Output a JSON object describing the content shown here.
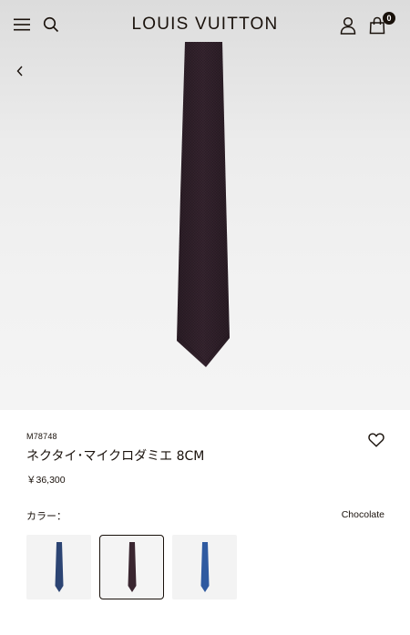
{
  "header": {
    "logo": "LOUIS VUITTON",
    "cart_count": "0",
    "icons": [
      "menu-icon",
      "search-icon",
      "account-icon",
      "shopping-bag-icon",
      "back-arrow-icon"
    ]
  },
  "product": {
    "sku": "M78748",
    "name": "ネクタイ･マイクロダミエ 8CM",
    "price": "￥36,300",
    "wishlist_icon": "heart-icon"
  },
  "color_selector": {
    "label": "カラー：",
    "selected_value": "Chocolate",
    "swatches": [
      {
        "name": "navy",
        "color": "#2c4473",
        "selected": false
      },
      {
        "name": "chocolate",
        "color": "#3a2630",
        "selected": true
      },
      {
        "name": "blue",
        "color": "#2f5aa0",
        "selected": false
      }
    ]
  },
  "colors": {
    "text": "#19110b",
    "tie_main": "#35242f",
    "hero_bg": "#ececec"
  }
}
